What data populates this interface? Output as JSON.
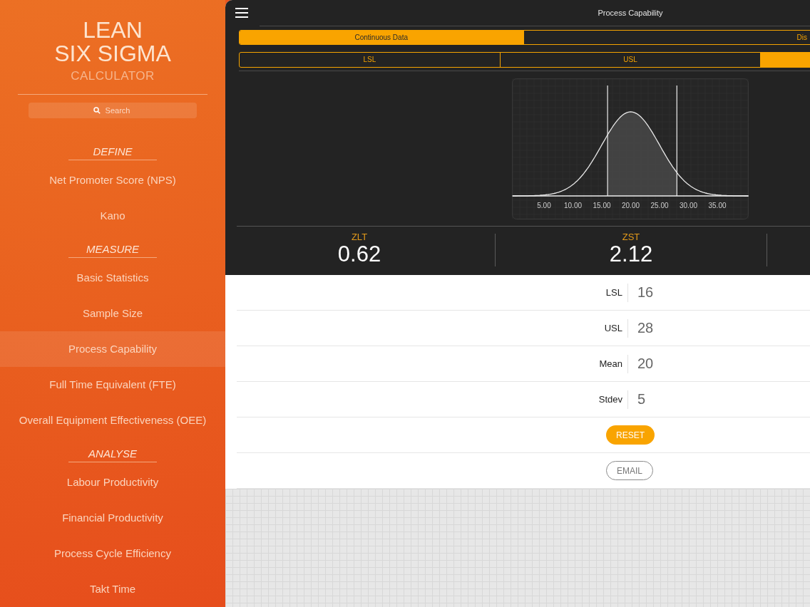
{
  "sidebar": {
    "title_lines": [
      "LEAN",
      "SIX SIGMA"
    ],
    "subtitle": "CALCULATOR",
    "search": {
      "placeholder": "Search"
    },
    "sections": [
      {
        "heading": "DEFINE",
        "items": [
          {
            "label": "Net Promoter Score (NPS)",
            "selected": false
          },
          {
            "label": "Kano",
            "selected": false
          }
        ]
      },
      {
        "heading": "MEASURE",
        "items": [
          {
            "label": "Basic Statistics",
            "selected": false
          },
          {
            "label": "Sample Size",
            "selected": false
          },
          {
            "label": "Process Capability",
            "selected": true
          },
          {
            "label": "Full Time Equivalent (FTE)",
            "selected": false
          },
          {
            "label": "Overall Equipment Effectiveness (OEE)",
            "selected": false
          }
        ]
      },
      {
        "heading": "ANALYSE",
        "items": [
          {
            "label": "Labour Productivity",
            "selected": false
          },
          {
            "label": "Financial Productivity",
            "selected": false
          },
          {
            "label": "Process Cycle Efficiency",
            "selected": false
          },
          {
            "label": "Takt Time",
            "selected": false
          }
        ]
      }
    ]
  },
  "header": {
    "title": "Process Capability"
  },
  "data_type_tabs": [
    {
      "label": "Continuous Data",
      "selected": true
    },
    {
      "label": "Dis",
      "selected": false
    }
  ],
  "limit_tabs": [
    {
      "label": "LSL",
      "selected": false
    },
    {
      "label": "USL",
      "selected": false
    },
    {
      "selected": true
    }
  ],
  "chart": {
    "x_tick_labels": [
      "5.00",
      "10.00",
      "15.00",
      "20.00",
      "25.00",
      "30.00",
      "35.00"
    ]
  },
  "metrics": [
    {
      "label": "ZLT",
      "value": "0.62"
    },
    {
      "label": "ZST",
      "value": "2.12"
    }
  ],
  "fields": [
    {
      "label": "LSL",
      "value": "16"
    },
    {
      "label": "USL",
      "value": "28"
    },
    {
      "label": "Mean",
      "value": "20"
    },
    {
      "label": "Stdev",
      "value": "5"
    }
  ],
  "buttons": [
    {
      "label": "RESET",
      "kind": "filled"
    },
    {
      "label": "EMAIL",
      "kind": "outline"
    }
  ]
}
